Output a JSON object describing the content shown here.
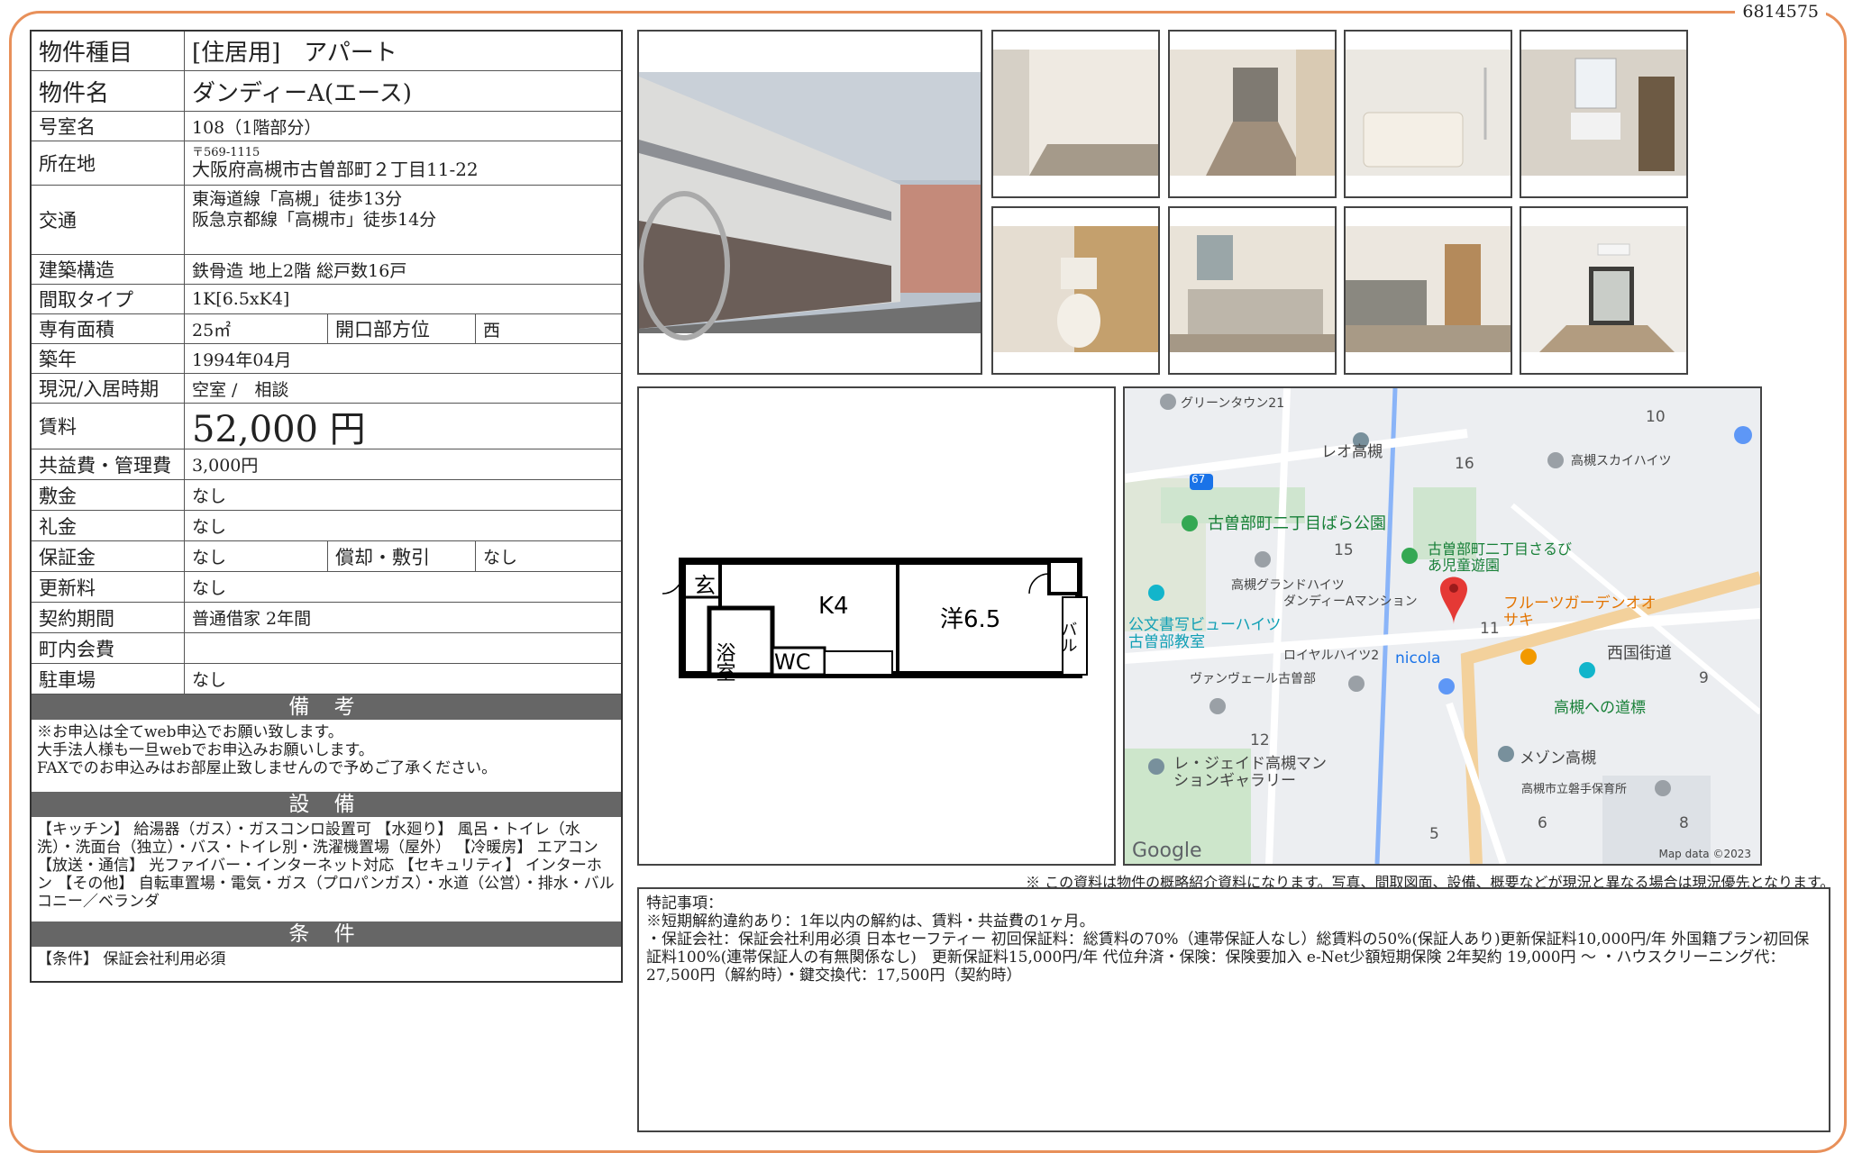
{
  "doc_id": "6814575",
  "property": {
    "type_label": "物件種目",
    "type_value": "[住居用]　アパート",
    "name_label": "物件名",
    "name_value": "ダンディーA(エース)",
    "room_label": "号室名",
    "room_value": "108（1階部分）",
    "address_label": "所在地",
    "postal": "〒569-1115",
    "address": "大阪府高槻市古曽部町２丁目11-22",
    "traffic_label": "交通",
    "traffic_1": "東海道線「高槻」徒歩13分",
    "traffic_2": "阪急京都線「高槻市」徒歩14分",
    "structure_label": "建築構造",
    "structure_value": "鉄骨造 地上2階 総戸数16戸",
    "layout_label": "間取タイプ",
    "layout_value": "1K[6.5xK4]",
    "area_label": "専有面積",
    "area_value": "25㎡",
    "facing_label": "開口部方位",
    "facing_value": "西",
    "built_label": "築年",
    "built_value": "1994年04月",
    "status_label": "現況/入居時期",
    "status_value": "空室 /　相談",
    "rent_label": "賃料",
    "rent_value": "52,000 円",
    "fee_label": "共益費・管理費",
    "fee_value": "3,000円",
    "deposit_label": "敷金",
    "deposit_value": "なし",
    "key_money_label": "礼金",
    "key_money_value": "なし",
    "guarantee_label": "保証金",
    "guarantee_value": "なし",
    "amort_label": "償却・敷引",
    "amort_value": "なし",
    "renewal_label": "更新料",
    "renewal_value": "なし",
    "contract_label": "契約期間",
    "contract_value": "普通借家 2年間",
    "town_label": "町内会費",
    "town_value": "",
    "parking_label": "駐車場",
    "parking_value": "なし"
  },
  "remarks": {
    "title": "備 考",
    "line1": "※お申込は全てweb申込でお願い致します。",
    "line2": "大手法人様も一旦webでお申込みお願いします。",
    "line3": "FAXでのお申込みはお部屋止致しませんので予めご了承ください。"
  },
  "equipment": {
    "title": "設 備",
    "text": "【キッチン】 給湯器（ガス）・ガスコンロ設置可 【水廻り】 風呂・トイレ（水洗）・洗面台（独立）・バス・トイレ別・洗濯機置場（屋外） 【冷暖房】 エアコン 【放送・通信】 光ファイバー・インターネット対応 【セキュリティ】 インターホン 【その他】 自転車置場・電気・ガス（プロパンガス）・水道（公営）・排水・バルコニー／ベランダ"
  },
  "conditions": {
    "title": "条 件",
    "text": "【条件】 保証会社利用必須"
  },
  "floorplan": {
    "entrance": "玄",
    "bath": "浴室",
    "wc": "WC",
    "kitchen": "K4",
    "western": "洋6.5",
    "balcony": "バル"
  },
  "map": {
    "labels": [
      "グリーンタウン21",
      "レオ高槻",
      "高槻スカイハイツ",
      "古曽部町二丁目ばら公園",
      "古曽部町二丁目さるびあ児童遊園",
      "高槻グランドハイツ",
      "ダンディーAマンション",
      "公文書写ビューハイツ古曽部教室",
      "フルーツガーデンオオサキ",
      "ロイヤルハイツ2",
      "nicola",
      "西国街道",
      "ヴァンヴェール古曽部",
      "高槻への道標",
      "レ・ジェイド高槻マンションギャラリー",
      "メゾン高槻",
      "高槻市立磐手保育所"
    ],
    "numbers": [
      "10",
      "16",
      "15",
      "11",
      "9",
      "12",
      "5",
      "6",
      "8",
      "67"
    ],
    "google": "Google",
    "credit": "Map data ©2023"
  },
  "note": "※ この資料は物件の概略紹介資料になります。写真、間取図面、設備、概要などが現況と異なる場合は現況優先となります。",
  "special": {
    "title": "特記事項：",
    "line1": "※短期解約違約あり：1年以内の解約は、賃料・共益費の1ヶ月。",
    "line2": "・保証会社：保証会社利用必須 日本セーフティー 初回保証料：総賃料の70%（連帯保証人なし）総賃料の50%(保証人あり)更新保証料10,000円/年 外国籍プラン初回保証料100%(連帯保証人の有無関係なし)　更新保証料15,000円/年 代位弁済・保険：保険要加入 e-Net少額短期保険 2年契約 19,000円 ～ ・ハウスクリーニング代：27,500円（解約時）・鍵交換代：17,500円（契約時）"
  },
  "colors": {
    "frame": "#e8905a",
    "section_header": "#666666",
    "map_pin": "#e53935"
  }
}
